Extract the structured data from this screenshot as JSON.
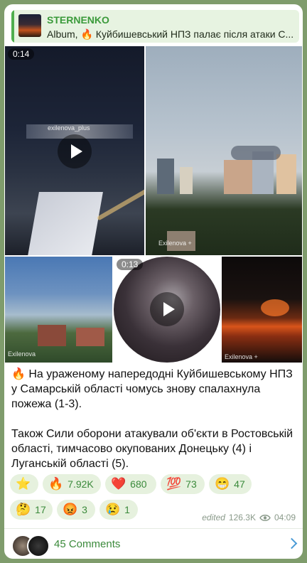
{
  "reply": {
    "channel": "STERNENKO",
    "preview": "Album, 🔥 Куйбишевський НПЗ палає після атаки С..."
  },
  "media": [
    {
      "type": "video",
      "duration": "0:14",
      "watermark": "exilenova_plus"
    },
    {
      "type": "photo",
      "watermark": "Exilenova +"
    },
    {
      "type": "photo",
      "watermark": "Exilenova"
    },
    {
      "type": "video",
      "duration": "0:13"
    },
    {
      "type": "photo",
      "watermark": "Exilenova +"
    }
  ],
  "caption": "🔥 На ураженому напередодні Куйбишевському НПЗ у Самарській області чомусь знову спалахнула пожежа (1-3).\n\nТакож Сили оборони атакували об'єкти в Ростовській області, тимчасово окупованих Донецьку (4) і Луганській області (5).",
  "reactions": [
    {
      "emoji": "⭐",
      "count": ""
    },
    {
      "emoji": "🔥",
      "count": "7.92K"
    },
    {
      "emoji": "❤️",
      "count": "680"
    },
    {
      "emoji": "💯",
      "count": "73"
    },
    {
      "emoji": "😁",
      "count": "47"
    },
    {
      "emoji": "🤔",
      "count": "17"
    },
    {
      "emoji": "😡",
      "count": "3"
    },
    {
      "emoji": "😢",
      "count": "1"
    }
  ],
  "meta": {
    "edited": "edited",
    "views": "126.3K",
    "time": "04:09"
  },
  "comments": {
    "label": "45 Comments"
  },
  "colors": {
    "accent": "#3b8a3b",
    "bubble": "#ffffff",
    "reaction_bg": "#e6f1de",
    "background": "#7f9c6c"
  }
}
